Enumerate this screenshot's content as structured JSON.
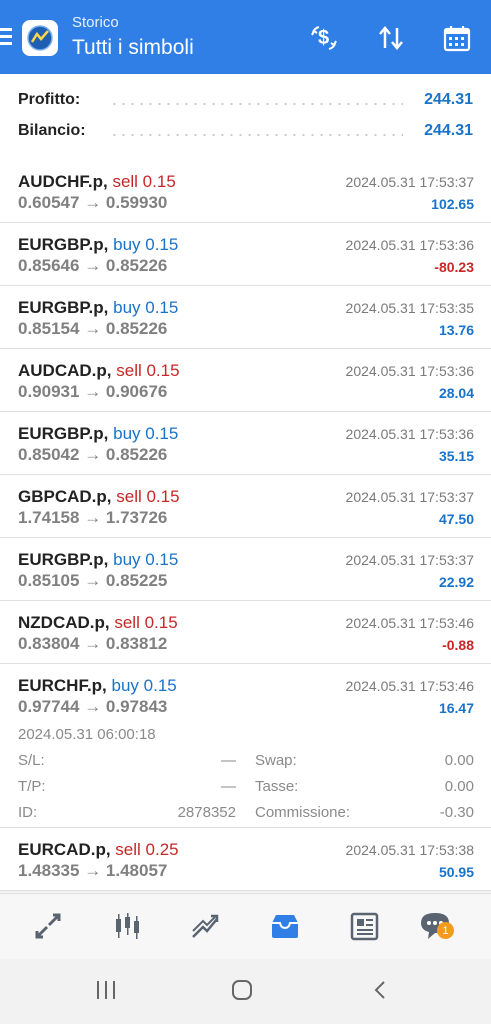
{
  "header": {
    "subtitle": "Storico",
    "title": "Tutti i simboli"
  },
  "summary": {
    "profit_label": "Profitto:",
    "profit_value": "244.31",
    "balance_label": "Bilancio:",
    "balance_value": "244.31"
  },
  "deals": [
    {
      "symbol": "AUDCHF.p,",
      "side": "sell 0.15",
      "open": "0.60547",
      "close": "0.59930",
      "time": "2024.05.31 17:53:37",
      "profit": "102.65"
    },
    {
      "symbol": "EURGBP.p,",
      "side": "buy 0.15",
      "open": "0.85646",
      "close": "0.85226",
      "time": "2024.05.31 17:53:36",
      "profit": "-80.23"
    },
    {
      "symbol": "EURGBP.p,",
      "side": "buy 0.15",
      "open": "0.85154",
      "close": "0.85226",
      "time": "2024.05.31 17:53:35",
      "profit": "13.76"
    },
    {
      "symbol": "AUDCAD.p,",
      "side": "sell 0.15",
      "open": "0.90931",
      "close": "0.90676",
      "time": "2024.05.31 17:53:36",
      "profit": "28.04"
    },
    {
      "symbol": "EURGBP.p,",
      "side": "buy 0.15",
      "open": "0.85042",
      "close": "0.85226",
      "time": "2024.05.31 17:53:36",
      "profit": "35.15"
    },
    {
      "symbol": "GBPCAD.p,",
      "side": "sell 0.15",
      "open": "1.74158",
      "close": "1.73726",
      "time": "2024.05.31 17:53:37",
      "profit": "47.50"
    },
    {
      "symbol": "EURGBP.p,",
      "side": "buy 0.15",
      "open": "0.85105",
      "close": "0.85225",
      "time": "2024.05.31 17:53:37",
      "profit": "22.92"
    },
    {
      "symbol": "NZDCAD.p,",
      "side": "sell 0.15",
      "open": "0.83804",
      "close": "0.83812",
      "time": "2024.05.31 17:53:46",
      "profit": "-0.88"
    },
    {
      "symbol": "EURCHF.p,",
      "side": "buy 0.15",
      "open": "0.97744",
      "close": "0.97843",
      "time": "2024.05.31 17:53:46",
      "profit": "16.47"
    },
    {
      "symbol": "EURCAD.p,",
      "side": "sell 0.25",
      "open": "1.48335",
      "close": "1.48057",
      "time": "2024.05.31 17:53:38",
      "profit": "50.95"
    }
  ],
  "arrow": "→",
  "expanded": {
    "open_time": "2024.05.31 06:00:18",
    "sl_label": "S/L:",
    "sl_value": "—",
    "tp_label": "T/P:",
    "tp_value": "—",
    "id_label": "ID:",
    "id_value": "2878352",
    "swap_label": "Swap:",
    "swap_value": "0.00",
    "tax_label": "Tasse:",
    "tax_value": "0.00",
    "commission_label": "Commissione:",
    "commission_value": "-0.30"
  },
  "bottom_nav": {
    "items": [
      "quotes-icon",
      "chart-icon",
      "trade-icon",
      "history-icon",
      "news-icon",
      "chat-icon"
    ],
    "chat_badge": "1"
  },
  "colors": {
    "accent": "#2f7fe6",
    "positive": "#1a73c8",
    "negative": "#c62828",
    "badge": "#f29b1d"
  }
}
